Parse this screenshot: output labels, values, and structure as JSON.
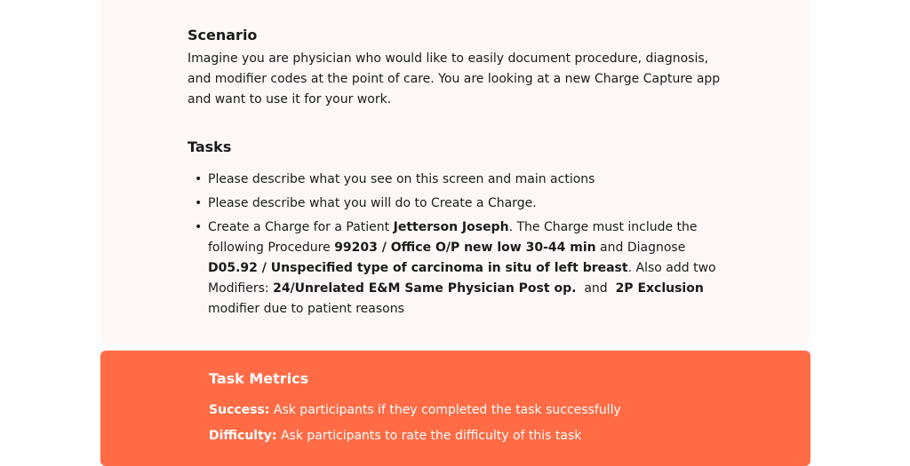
{
  "scenario": {
    "title": "Scenario",
    "body": "Imagine you are physician who would like to easily document procedure, diagnosis, and modifier codes at the point of care. You are looking at a new Charge Capture app and want to use it for your work."
  },
  "tasks": {
    "title": "Tasks",
    "bullet": "•",
    "item1": "Please describe what you see on this screen and main actions",
    "item2": "Please describe what you will do to Create a Charge.",
    "item3": {
      "t1": "Create a Charge for a Patient ",
      "patient": "Jetterson Joseph",
      "t2": ". The Charge must include the following Procedure ",
      "procedure": "99203 / Office O/P new low 30-44 min",
      "t3": " and Diagnose ",
      "diagnosis": "D05.92 / Unspecified type of carcinoma in situ of left breast",
      "t4": ". Also add two Modifiers: ",
      "modifier1": "24/Unrelated E&M Same Physician Post op.",
      "t5": "  and  ",
      "modifier2": "2P Exclusion",
      "t6": " modifier due to patient reasons"
    }
  },
  "metrics": {
    "title": "Task Metrics",
    "success_label": "Success:",
    "success_text": " Ask participants if they completed the task successfully",
    "difficulty_label": "Difficulty:",
    "difficulty_text": " Ask participants to rate the difficulty of this task"
  },
  "colors": {
    "card_background": "#fdf8f5",
    "metrics_background": "#ff6b45"
  }
}
